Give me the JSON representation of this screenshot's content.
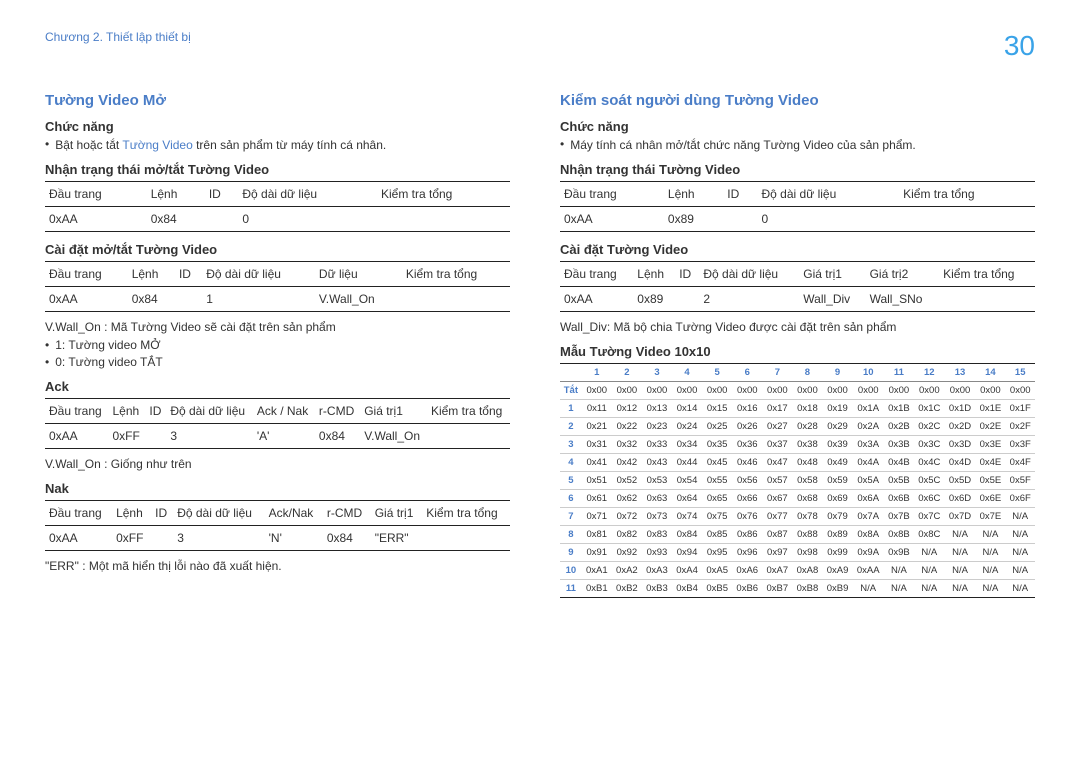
{
  "header": {
    "chapter": "Chương 2. Thiết lập thiết bị",
    "page": "30"
  },
  "left": {
    "title": "Tường Video Mở",
    "func_h": "Chức năng",
    "func_b_pre": "Bật hoặc tắt ",
    "func_b_blue": "Tường Video",
    "func_b_post": " trên sản phẩm từ máy tính cá nhân.",
    "tbl1_h": "Nhận trạng thái mở/tắt Tường Video",
    "tbl1_head": [
      "Đầu trang",
      "Lệnh",
      "ID",
      "Độ dài dữ liệu",
      "Kiểm tra tổng"
    ],
    "tbl1_row": [
      "0xAA",
      "0x84",
      "",
      "0",
      ""
    ],
    "tbl2_h": "Cài đặt mở/tắt Tường Video",
    "tbl2_head": [
      "Đầu trang",
      "Lệnh",
      "ID",
      "Độ dài dữ liệu",
      "Dữ liệu",
      "Kiểm tra tổng"
    ],
    "tbl2_row": [
      "0xAA",
      "0x84",
      "",
      "1",
      "V.Wall_On",
      ""
    ],
    "note1": "V.Wall_On : Mã Tường Video sẽ cài đặt trên sản phẩm",
    "note_b1": "1: Tường video MỞ",
    "note_b2": "0: Tường video TẮT",
    "ack_h": "Ack",
    "ack_head": [
      "Đầu trang",
      "Lệnh",
      "ID",
      "Độ dài dữ liệu",
      "Ack / Nak",
      "r-CMD",
      "Giá trị1",
      "Kiểm tra tổng"
    ],
    "ack_row": [
      "0xAA",
      "0xFF",
      "",
      "3",
      "'A'",
      "0x84",
      "V.Wall_On",
      ""
    ],
    "ack_note": "V.Wall_On : Giống như trên",
    "nak_h": "Nak",
    "nak_head": [
      "Đầu trang",
      "Lệnh",
      "ID",
      "Độ dài dữ liệu",
      "Ack/Nak",
      "r-CMD",
      "Giá trị1",
      "Kiểm tra tổng"
    ],
    "nak_row": [
      "0xAA",
      "0xFF",
      "",
      "3",
      "'N'",
      "0x84",
      "\"ERR\"",
      ""
    ],
    "nak_note": "\"ERR\" : Một mã hiển thị lỗi nào đã xuất hiện."
  },
  "right": {
    "title": "Kiểm soát người dùng Tường Video",
    "func_h": "Chức năng",
    "func_b": "Máy tính cá nhân mở/tắt chức năng Tường Video của sản phẩm.",
    "tbl1_h": "Nhận trạng thái Tường Video",
    "tbl1_head": [
      "Đầu trang",
      "Lệnh",
      "ID",
      "Độ dài dữ liệu",
      "Kiểm tra tổng"
    ],
    "tbl1_row": [
      "0xAA",
      "0x89",
      "",
      "0",
      ""
    ],
    "tbl2_h": "Cài đặt Tường Video",
    "tbl2_head": [
      "Đầu trang",
      "Lệnh",
      "ID",
      "Độ dài dữ liệu",
      "Giá trị1",
      "Giá trị2",
      "Kiểm tra tổng"
    ],
    "tbl2_row": [
      "0xAA",
      "0x89",
      "",
      "2",
      "Wall_Div",
      "Wall_SNo",
      ""
    ],
    "note1": "Wall_Div: Mã bộ chia Tường Video được cài đặt trên sản phẩm",
    "matrix_h": "Mẫu Tường Video 10x10",
    "matrix_cols": [
      "",
      "1",
      "2",
      "3",
      "4",
      "5",
      "6",
      "7",
      "8",
      "9",
      "10",
      "11",
      "12",
      "13",
      "14",
      "15"
    ],
    "matrix_rows": [
      [
        "Tắt",
        "0x00",
        "0x00",
        "0x00",
        "0x00",
        "0x00",
        "0x00",
        "0x00",
        "0x00",
        "0x00",
        "0x00",
        "0x00",
        "0x00",
        "0x00",
        "0x00",
        "0x00"
      ],
      [
        "1",
        "0x11",
        "0x12",
        "0x13",
        "0x14",
        "0x15",
        "0x16",
        "0x17",
        "0x18",
        "0x19",
        "0x1A",
        "0x1B",
        "0x1C",
        "0x1D",
        "0x1E",
        "0x1F"
      ],
      [
        "2",
        "0x21",
        "0x22",
        "0x23",
        "0x24",
        "0x25",
        "0x26",
        "0x27",
        "0x28",
        "0x29",
        "0x2A",
        "0x2B",
        "0x2C",
        "0x2D",
        "0x2E",
        "0x2F"
      ],
      [
        "3",
        "0x31",
        "0x32",
        "0x33",
        "0x34",
        "0x35",
        "0x36",
        "0x37",
        "0x38",
        "0x39",
        "0x3A",
        "0x3B",
        "0x3C",
        "0x3D",
        "0x3E",
        "0x3F"
      ],
      [
        "4",
        "0x41",
        "0x42",
        "0x43",
        "0x44",
        "0x45",
        "0x46",
        "0x47",
        "0x48",
        "0x49",
        "0x4A",
        "0x4B",
        "0x4C",
        "0x4D",
        "0x4E",
        "0x4F"
      ],
      [
        "5",
        "0x51",
        "0x52",
        "0x53",
        "0x54",
        "0x55",
        "0x56",
        "0x57",
        "0x58",
        "0x59",
        "0x5A",
        "0x5B",
        "0x5C",
        "0x5D",
        "0x5E",
        "0x5F"
      ],
      [
        "6",
        "0x61",
        "0x62",
        "0x63",
        "0x64",
        "0x65",
        "0x66",
        "0x67",
        "0x68",
        "0x69",
        "0x6A",
        "0x6B",
        "0x6C",
        "0x6D",
        "0x6E",
        "0x6F"
      ],
      [
        "7",
        "0x71",
        "0x72",
        "0x73",
        "0x74",
        "0x75",
        "0x76",
        "0x77",
        "0x78",
        "0x79",
        "0x7A",
        "0x7B",
        "0x7C",
        "0x7D",
        "0x7E",
        "N/A"
      ],
      [
        "8",
        "0x81",
        "0x82",
        "0x83",
        "0x84",
        "0x85",
        "0x86",
        "0x87",
        "0x88",
        "0x89",
        "0x8A",
        "0x8B",
        "0x8C",
        "N/A",
        "N/A",
        "N/A"
      ],
      [
        "9",
        "0x91",
        "0x92",
        "0x93",
        "0x94",
        "0x95",
        "0x96",
        "0x97",
        "0x98",
        "0x99",
        "0x9A",
        "0x9B",
        "N/A",
        "N/A",
        "N/A",
        "N/A"
      ],
      [
        "10",
        "0xA1",
        "0xA2",
        "0xA3",
        "0xA4",
        "0xA5",
        "0xA6",
        "0xA7",
        "0xA8",
        "0xA9",
        "0xAA",
        "N/A",
        "N/A",
        "N/A",
        "N/A",
        "N/A"
      ],
      [
        "11",
        "0xB1",
        "0xB2",
        "0xB3",
        "0xB4",
        "0xB5",
        "0xB6",
        "0xB7",
        "0xB8",
        "0xB9",
        "N/A",
        "N/A",
        "N/A",
        "N/A",
        "N/A",
        "N/A"
      ]
    ]
  }
}
